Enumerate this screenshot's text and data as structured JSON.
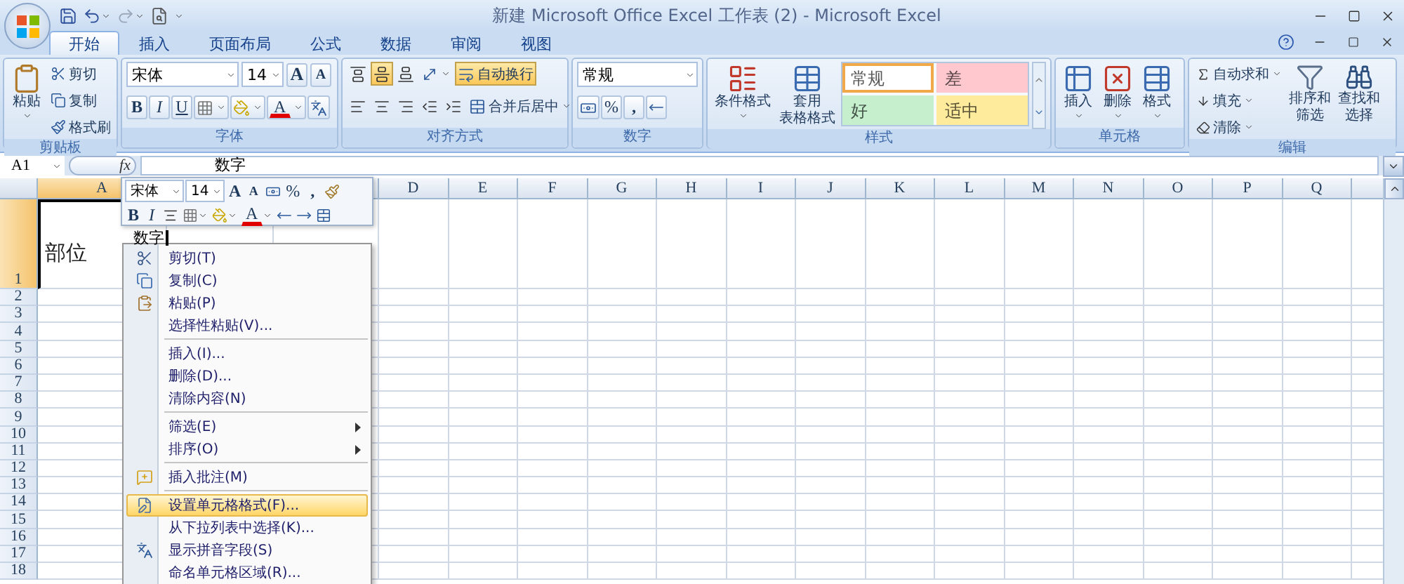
{
  "window": {
    "title": "新建 Microsoft Office Excel 工作表 (2) - Microsoft Excel"
  },
  "tabs": [
    {
      "label": "开始",
      "selected": true
    },
    {
      "label": "插入",
      "selected": false
    },
    {
      "label": "页面布局",
      "selected": false
    },
    {
      "label": "公式",
      "selected": false
    },
    {
      "label": "数据",
      "selected": false
    },
    {
      "label": "审阅",
      "selected": false
    },
    {
      "label": "视图",
      "selected": false
    }
  ],
  "ribbon": {
    "clipboard": {
      "label": "剪贴板",
      "paste": "粘贴",
      "items": [
        "剪切",
        "复制",
        "格式刷"
      ]
    },
    "font": {
      "label": "字体",
      "font_name": "宋体",
      "font_size": "14",
      "grow": "A",
      "shrink": "A",
      "bold": "B",
      "italic": "I",
      "underline": "U",
      "font_color": "A"
    },
    "alignment": {
      "label": "对齐方式",
      "vertical": [
        {
          "selected": false
        },
        {
          "selected": true
        },
        {
          "selected": false
        }
      ],
      "wrap_text": {
        "label": "自动换行",
        "on": true
      },
      "merge": "合并后居中"
    },
    "number": {
      "label": "数字",
      "format": "常规",
      "percent": "%",
      "comma": ","
    },
    "styles": {
      "label": "样式",
      "conditional": "条件格式",
      "table_format": [
        "套用",
        "表格格式"
      ],
      "cell_styles": [
        {
          "label": "常规",
          "color": "#ffffff",
          "selected": true
        },
        {
          "label": "差",
          "color": "#ffc7ce",
          "selected": false
        },
        {
          "label": "好",
          "color": "#c6efce",
          "selected": false
        },
        {
          "label": "适中",
          "color": "#ffeb9c",
          "selected": false
        }
      ]
    },
    "cells": {
      "label": "单元格",
      "buttons": [
        "插入",
        "删除",
        "格式"
      ]
    },
    "editing": {
      "label": "编辑",
      "items": [
        "自动求和",
        "填充",
        "清除"
      ],
      "sort": [
        "排序和",
        "筛选"
      ],
      "find": [
        "查找和",
        "选择"
      ]
    }
  },
  "formula_bar": {
    "cell": "A1",
    "fx": "fx",
    "content": "数字"
  },
  "sheet": {
    "columns": [
      {
        "kind": "column",
        "label": "A",
        "selected": true
      },
      {
        "kind": "covered"
      },
      {
        "kind": "covered"
      },
      {
        "kind": "column",
        "label": "D",
        "selected": false
      },
      {
        "kind": "column",
        "label": "E",
        "selected": false
      },
      {
        "kind": "column",
        "label": "F",
        "selected": false
      },
      {
        "kind": "column",
        "label": "G",
        "selected": false
      },
      {
        "kind": "column",
        "label": "H",
        "selected": false
      },
      {
        "kind": "column",
        "label": "I",
        "selected": false
      },
      {
        "kind": "column",
        "label": "J",
        "selected": false
      },
      {
        "kind": "column",
        "label": "K",
        "selected": false
      },
      {
        "kind": "column",
        "label": "L",
        "selected": false
      },
      {
        "kind": "column",
        "label": "M",
        "selected": false
      },
      {
        "kind": "column",
        "label": "N",
        "selected": false
      },
      {
        "kind": "column",
        "label": "O",
        "selected": false
      },
      {
        "kind": "column",
        "label": "P",
        "selected": false
      },
      {
        "kind": "column",
        "label": "Q",
        "selected": false
      }
    ],
    "rows": [
      {
        "label": "1",
        "selected": true,
        "cells": [
          {
            "text": "部位",
            "edit_text": "数字",
            "selected": true
          }
        ]
      },
      {
        "label": "2",
        "selected": false
      },
      {
        "label": "3",
        "selected": false
      },
      {
        "label": "4",
        "selected": false
      },
      {
        "label": "5",
        "selected": false
      },
      {
        "label": "6",
        "selected": false
      },
      {
        "label": "7",
        "selected": false
      },
      {
        "label": "8",
        "selected": false
      },
      {
        "label": "9",
        "selected": false
      },
      {
        "label": "10",
        "selected": false
      },
      {
        "label": "11",
        "selected": false
      },
      {
        "label": "12",
        "selected": false
      },
      {
        "label": "13",
        "selected": false
      },
      {
        "label": "14",
        "selected": false
      },
      {
        "label": "15",
        "selected": false
      },
      {
        "label": "16",
        "selected": false
      },
      {
        "label": "17",
        "selected": false
      },
      {
        "label": "18",
        "selected": false
      }
    ]
  },
  "mini_toolbar": {
    "font_name": "宋体",
    "font_size": "14",
    "grow": "A",
    "shrink": "A",
    "percent": "%",
    "comma": ",",
    "bold": "B",
    "italic": "I",
    "font_color": "A"
  },
  "context_menu": {
    "items": [
      {
        "kind": "item",
        "label": "剪切(T)",
        "submenu": false,
        "selected": false
      },
      {
        "kind": "item",
        "label": "复制(C)",
        "submenu": false,
        "selected": false
      },
      {
        "kind": "item",
        "label": "粘贴(P)",
        "submenu": false,
        "selected": false
      },
      {
        "kind": "item",
        "label": "选择性粘贴(V)...",
        "submenu": false,
        "selected": false
      },
      {
        "kind": "separator"
      },
      {
        "kind": "item",
        "label": "插入(I)...",
        "submenu": false,
        "selected": false
      },
      {
        "kind": "item",
        "label": "删除(D)...",
        "submenu": false,
        "selected": false
      },
      {
        "kind": "item",
        "label": "清除内容(N)",
        "submenu": false,
        "selected": false
      },
      {
        "kind": "separator"
      },
      {
        "kind": "item",
        "label": "筛选(E)",
        "submenu": true,
        "selected": false
      },
      {
        "kind": "item",
        "label": "排序(O)",
        "submenu": true,
        "selected": false
      },
      {
        "kind": "separator"
      },
      {
        "kind": "item",
        "label": "插入批注(M)",
        "submenu": false,
        "selected": false
      },
      {
        "kind": "separator"
      },
      {
        "kind": "item",
        "label": "设置单元格格式(F)...",
        "submenu": false,
        "selected": true
      },
      {
        "kind": "item",
        "label": "从下拉列表中选择(K)...",
        "submenu": false,
        "selected": false
      },
      {
        "kind": "item",
        "label": "显示拼音字段(S)",
        "submenu": false,
        "selected": false
      },
      {
        "kind": "item",
        "label": "命名单元格区域(R)...",
        "submenu": false,
        "selected": false
      }
    ]
  }
}
